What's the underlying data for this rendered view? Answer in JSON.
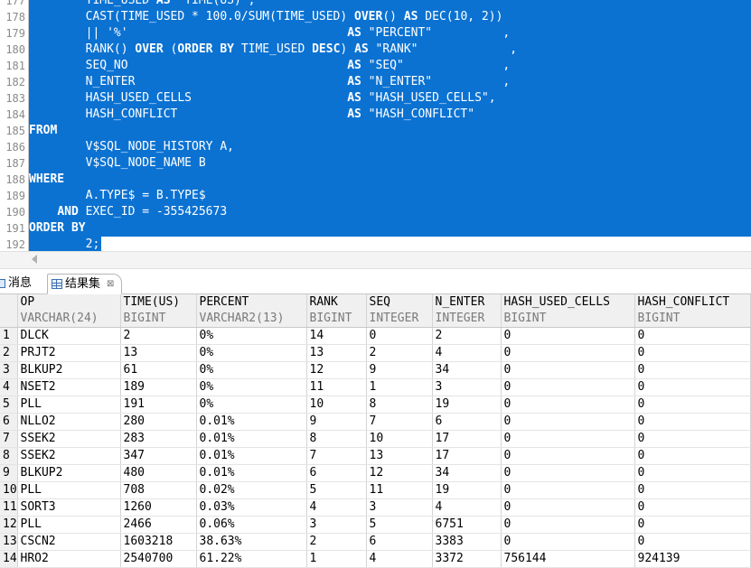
{
  "editor": {
    "lines": [
      {
        "num": "177",
        "parts": [
          [
            "",
            "        "
          ],
          [
            "",
            "TIME_USED "
          ],
          [
            "kw",
            "AS"
          ],
          [
            "",
            " \"TIME(US)\","
          ]
        ]
      },
      {
        "num": "178",
        "parts": [
          [
            "",
            "        CAST(TIME_USED * 100.0/SUM(TIME_USED) "
          ],
          [
            "kw",
            "OVER"
          ],
          [
            "",
            "() "
          ],
          [
            "kw",
            "AS"
          ],
          [
            "",
            " DEC(10, 2))"
          ]
        ]
      },
      {
        "num": "179",
        "parts": [
          [
            "",
            "        || '%'                               "
          ],
          [
            "kw",
            "AS"
          ],
          [
            "",
            " \"PERCENT\"          ,"
          ]
        ]
      },
      {
        "num": "180",
        "parts": [
          [
            "",
            "        RANK() "
          ],
          [
            "kw",
            "OVER"
          ],
          [
            "",
            " ("
          ],
          [
            "kw",
            "ORDER BY"
          ],
          [
            "",
            " TIME_USED "
          ],
          [
            "kw",
            "DESC"
          ],
          [
            "",
            ") "
          ],
          [
            "kw",
            "AS"
          ],
          [
            "",
            " \"RANK\"             ,"
          ]
        ]
      },
      {
        "num": "181",
        "parts": [
          [
            "",
            "        SEQ_NO                               "
          ],
          [
            "kw",
            "AS"
          ],
          [
            "",
            " \"SEQ\"              ,"
          ]
        ]
      },
      {
        "num": "182",
        "parts": [
          [
            "",
            "        N_ENTER                              "
          ],
          [
            "kw",
            "AS"
          ],
          [
            "",
            " \"N_ENTER\"          ,"
          ]
        ]
      },
      {
        "num": "183",
        "parts": [
          [
            "",
            "        HASH_USED_CELLS                      "
          ],
          [
            "kw",
            "AS"
          ],
          [
            "",
            " \"HASH_USED_CELLS\","
          ]
        ]
      },
      {
        "num": "184",
        "parts": [
          [
            "",
            "        HASH_CONFLICT                        "
          ],
          [
            "kw",
            "AS"
          ],
          [
            "",
            " \"HASH_CONFLICT\""
          ]
        ]
      },
      {
        "num": "185",
        "parts": [
          [
            "kw",
            "FROM"
          ]
        ]
      },
      {
        "num": "186",
        "parts": [
          [
            "",
            "        V$SQL_NODE_HISTORY A,"
          ]
        ]
      },
      {
        "num": "187",
        "parts": [
          [
            "",
            "        V$SQL_NODE_NAME B"
          ]
        ]
      },
      {
        "num": "188",
        "parts": [
          [
            "kw",
            "WHERE"
          ]
        ]
      },
      {
        "num": "189",
        "parts": [
          [
            "",
            "        A.TYPE$ = B.TYPE$"
          ]
        ]
      },
      {
        "num": "190",
        "parts": [
          [
            "",
            "    "
          ],
          [
            "kw",
            "AND"
          ],
          [
            "",
            " EXEC_ID = -355425673"
          ]
        ]
      },
      {
        "num": "191",
        "parts": [
          [
            "kw",
            "ORDER BY"
          ]
        ]
      },
      {
        "num": "192",
        "parts": [
          [
            "",
            "        2;"
          ]
        ]
      }
    ]
  },
  "tabs": {
    "messages_label": "消息",
    "results_label": "结果集",
    "results_close": "⊠"
  },
  "grid": {
    "columns": [
      {
        "name": "OP",
        "type": "VARCHAR(24)"
      },
      {
        "name": "TIME(US)",
        "type": "BIGINT"
      },
      {
        "name": "PERCENT",
        "type": "VARCHAR2(13)"
      },
      {
        "name": "RANK",
        "type": "BIGINT"
      },
      {
        "name": "SEQ",
        "type": "INTEGER"
      },
      {
        "name": "N_ENTER",
        "type": "INTEGER"
      },
      {
        "name": "HASH_USED_CELLS",
        "type": "BIGINT"
      },
      {
        "name": "HASH_CONFLICT",
        "type": "BIGINT"
      }
    ],
    "rows": [
      {
        "num": "1",
        "cells": [
          "DLCK",
          "2",
          "0%",
          "14",
          "0",
          "2",
          "0",
          "0"
        ]
      },
      {
        "num": "2",
        "cells": [
          "PRJT2",
          "13",
          "0%",
          "13",
          "2",
          "4",
          "0",
          "0"
        ]
      },
      {
        "num": "3",
        "cells": [
          "BLKUP2",
          "61",
          "0%",
          "12",
          "9",
          "34",
          "0",
          "0"
        ]
      },
      {
        "num": "4",
        "cells": [
          "NSET2",
          "189",
          "0%",
          "11",
          "1",
          "3",
          "0",
          "0"
        ]
      },
      {
        "num": "5",
        "cells": [
          "PLL",
          "191",
          "0%",
          "10",
          "8",
          "19",
          "0",
          "0"
        ]
      },
      {
        "num": "6",
        "cells": [
          "NLLO2",
          "280",
          "0.01%",
          "9",
          "7",
          "6",
          "0",
          "0"
        ]
      },
      {
        "num": "7",
        "cells": [
          "SSEK2",
          "283",
          "0.01%",
          "8",
          "10",
          "17",
          "0",
          "0"
        ]
      },
      {
        "num": "8",
        "cells": [
          "SSEK2",
          "347",
          "0.01%",
          "7",
          "13",
          "17",
          "0",
          "0"
        ]
      },
      {
        "num": "9",
        "cells": [
          "BLKUP2",
          "480",
          "0.01%",
          "6",
          "12",
          "34",
          "0",
          "0"
        ]
      },
      {
        "num": "10",
        "cells": [
          "PLL",
          "708",
          "0.02%",
          "5",
          "11",
          "19",
          "0",
          "0"
        ]
      },
      {
        "num": "11",
        "cells": [
          "SORT3",
          "1260",
          "0.03%",
          "4",
          "3",
          "4",
          "0",
          "0"
        ]
      },
      {
        "num": "12",
        "cells": [
          "PLL",
          "2466",
          "0.06%",
          "3",
          "5",
          "6751",
          "0",
          "0"
        ]
      },
      {
        "num": "13",
        "cells": [
          "CSCN2",
          "1603218",
          "38.63%",
          "2",
          "6",
          "3383",
          "0",
          "0"
        ]
      },
      {
        "num": "14",
        "cells": [
          "HRO2",
          "2540700",
          "61.22%",
          "1",
          "4",
          "3372",
          "756144",
          "924139"
        ]
      }
    ]
  },
  "colors": {
    "selection": "#0b72d2",
    "header_bg": "#f0f0f0"
  }
}
